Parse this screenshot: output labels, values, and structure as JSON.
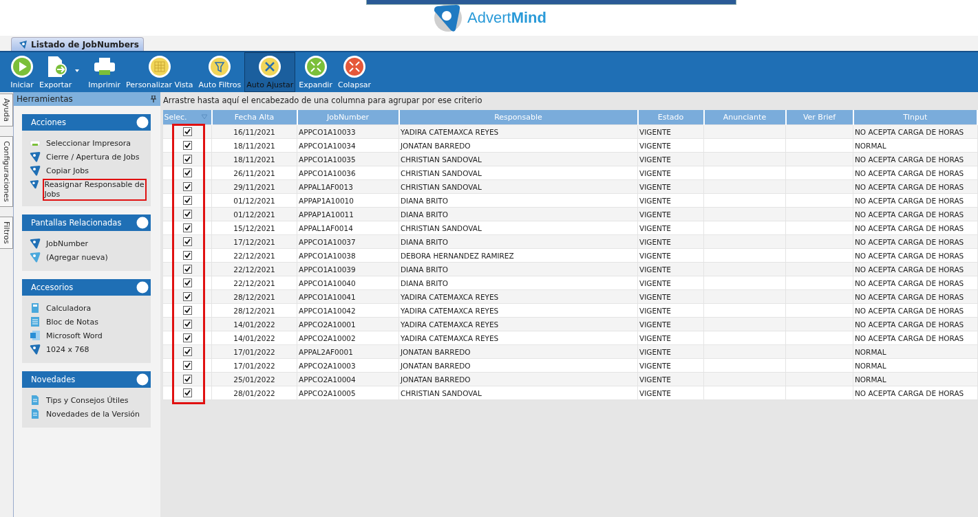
{
  "logo": {
    "text": "Advert**Mind**"
  },
  "document_tab": {
    "label": "Listado de JobNumbers",
    "selected": true
  },
  "toolbar": [
    {
      "label": "Iniciar",
      "kind": "play",
      "selected": false,
      "dropdown": false
    },
    {
      "label": "Exportar",
      "kind": "export",
      "selected": false,
      "dropdown": true
    },
    {
      "label": "Imprimir",
      "kind": "print",
      "selected": false,
      "dropdown": false
    },
    {
      "label": "Personalizar Vista",
      "kind": "grid",
      "selected": false,
      "dropdown": false
    },
    {
      "label": "Auto Filtros",
      "kind": "filter",
      "selected": false,
      "dropdown": false
    },
    {
      "label": "Auto Ajustar",
      "kind": "tools",
      "selected": true,
      "dropdown": false
    },
    {
      "label": "Expandir",
      "kind": "expand",
      "selected": false,
      "dropdown": false
    },
    {
      "label": "Colapsar",
      "kind": "collapse",
      "selected": false,
      "dropdown": false
    }
  ],
  "side_tabs": [
    "Ayuda",
    "Configuraciones",
    "Filtros"
  ],
  "sidebar": {
    "title": "Herramientas",
    "groups": [
      {
        "title": "Acciones",
        "items": [
          {
            "label": "Seleccionar Impresora",
            "kind": "printer",
            "highlighted": false
          },
          {
            "label": "Cierre / Apertura de Jobs",
            "kind": "logo",
            "highlighted": false
          },
          {
            "label": "Copiar Jobs",
            "kind": "logo",
            "highlighted": false
          },
          {
            "label": "Reasignar Responsable de Jobs",
            "kind": "logo",
            "highlighted": true
          }
        ]
      },
      {
        "title": "Pantallas Relacionadas",
        "items": [
          {
            "label": "JobNumber",
            "kind": "logo",
            "highlighted": false
          },
          {
            "label": "(Agregar nueva)",
            "kind": "logo-light",
            "highlighted": false
          }
        ]
      },
      {
        "title": "Accesorios",
        "items": [
          {
            "label": "Calculadora",
            "kind": "calculator",
            "highlighted": false
          },
          {
            "label": "Bloc de Notas",
            "kind": "notepad",
            "highlighted": false
          },
          {
            "label": "Microsoft Word",
            "kind": "word",
            "highlighted": false
          },
          {
            "label": "1024 x 768",
            "kind": "logo",
            "highlighted": false
          }
        ]
      },
      {
        "title": "Novedades",
        "items": [
          {
            "label": "Tips y Consejos Útiles",
            "kind": "doc",
            "highlighted": false
          },
          {
            "label": "Novedades de la Versión",
            "kind": "doc",
            "highlighted": false
          }
        ]
      }
    ]
  },
  "group_panel": {
    "hint": "Arrastre hasta aquí el encabezado de una columna para agrupar por ese criterio"
  },
  "table": {
    "select_column_highlighted": true,
    "columns": [
      "Selec.",
      "Fecha Alta",
      "JobNumber",
      "Responsable",
      "Estado",
      "Anunciante",
      "Ver Brief",
      "TInput"
    ],
    "rows": [
      {
        "checked": true,
        "fecha": "16/11/2021",
        "job": "APPCO1A10033",
        "responsable": "YADIRA CATEMAXCA REYES",
        "estado": "VIGENTE",
        "tinput": "NO ACEPTA CARGA DE HORAS"
      },
      {
        "checked": true,
        "fecha": "18/11/2021",
        "job": "APPCO1A10034",
        "responsable": "JONATAN BARREDO",
        "estado": "VIGENTE",
        "tinput": "NORMAL"
      },
      {
        "checked": true,
        "fecha": "18/11/2021",
        "job": "APPCO1A10035",
        "responsable": "CHRISTIAN SANDOVAL",
        "estado": "VIGENTE",
        "tinput": "NO ACEPTA CARGA DE HORAS"
      },
      {
        "checked": true,
        "fecha": "26/11/2021",
        "job": "APPCO1A10036",
        "responsable": "CHRISTIAN SANDOVAL",
        "estado": "VIGENTE",
        "tinput": "NO ACEPTA CARGA DE HORAS"
      },
      {
        "checked": true,
        "fecha": "29/11/2021",
        "job": "APPAL1AF0013",
        "responsable": "CHRISTIAN SANDOVAL",
        "estado": "VIGENTE",
        "tinput": "NO ACEPTA CARGA DE HORAS"
      },
      {
        "checked": true,
        "fecha": "01/12/2021",
        "job": "APPAP1A10010",
        "responsable": "DIANA BRITO",
        "estado": "VIGENTE",
        "tinput": "NO ACEPTA CARGA DE HORAS"
      },
      {
        "checked": true,
        "fecha": "01/12/2021",
        "job": "APPAP1A10011",
        "responsable": "DIANA BRITO",
        "estado": "VIGENTE",
        "tinput": "NO ACEPTA CARGA DE HORAS"
      },
      {
        "checked": true,
        "fecha": "15/12/2021",
        "job": "APPAL1AF0014",
        "responsable": "CHRISTIAN SANDOVAL",
        "estado": "VIGENTE",
        "tinput": "NO ACEPTA CARGA DE HORAS"
      },
      {
        "checked": true,
        "fecha": "17/12/2021",
        "job": "APPCO1A10037",
        "responsable": "DIANA BRITO",
        "estado": "VIGENTE",
        "tinput": "NO ACEPTA CARGA DE HORAS"
      },
      {
        "checked": true,
        "fecha": "22/12/2021",
        "job": "APPCO1A10038",
        "responsable": "DEBORA HERNANDEZ RAMIREZ",
        "estado": "VIGENTE",
        "tinput": "NO ACEPTA CARGA DE HORAS"
      },
      {
        "checked": true,
        "fecha": "22/12/2021",
        "job": "APPCO1A10039",
        "responsable": "DIANA BRITO",
        "estado": "VIGENTE",
        "tinput": "NO ACEPTA CARGA DE HORAS"
      },
      {
        "checked": true,
        "fecha": "22/12/2021",
        "job": "APPCO1A10040",
        "responsable": "DIANA BRITO",
        "estado": "VIGENTE",
        "tinput": "NO ACEPTA CARGA DE HORAS"
      },
      {
        "checked": true,
        "fecha": "28/12/2021",
        "job": "APPCO1A10041",
        "responsable": "YADIRA CATEMAXCA REYES",
        "estado": "VIGENTE",
        "tinput": "NO ACEPTA CARGA DE HORAS"
      },
      {
        "checked": true,
        "fecha": "28/12/2021",
        "job": "APPCO1A10042",
        "responsable": "YADIRA CATEMAXCA REYES",
        "estado": "VIGENTE",
        "tinput": "NO ACEPTA CARGA DE HORAS"
      },
      {
        "checked": true,
        "fecha": "14/01/2022",
        "job": "APPCO2A10001",
        "responsable": "YADIRA CATEMAXCA REYES",
        "estado": "VIGENTE",
        "tinput": "NO ACEPTA CARGA DE HORAS"
      },
      {
        "checked": true,
        "fecha": "14/01/2022",
        "job": "APPCO2A10002",
        "responsable": "YADIRA CATEMAXCA REYES",
        "estado": "VIGENTE",
        "tinput": "NO ACEPTA CARGA DE HORAS"
      },
      {
        "checked": true,
        "fecha": "17/01/2022",
        "job": "APPAL2AF0001",
        "responsable": "JONATAN BARREDO",
        "estado": "VIGENTE",
        "tinput": "NORMAL"
      },
      {
        "checked": true,
        "fecha": "17/01/2022",
        "job": "APPCO2A10003",
        "responsable": "JONATAN BARREDO",
        "estado": "VIGENTE",
        "tinput": "NORMAL"
      },
      {
        "checked": true,
        "fecha": "25/01/2022",
        "job": "APPCO2A10004",
        "responsable": "JONATAN BARREDO",
        "estado": "VIGENTE",
        "tinput": "NORMAL"
      },
      {
        "checked": true,
        "fecha": "28/01/2022",
        "job": "APPCO2A10005",
        "responsable": "CHRISTIAN SANDOVAL",
        "estado": "VIGENTE",
        "tinput": "NO ACEPTA CARGA DE HORAS"
      }
    ]
  }
}
